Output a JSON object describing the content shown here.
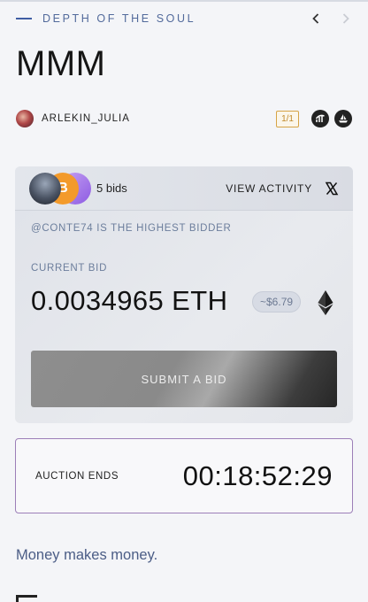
{
  "collection": {
    "name": "DEPTH OF THE SOUL"
  },
  "artwork": {
    "title": "MMM",
    "description": "Money makes money."
  },
  "creator": {
    "name": "ARLEKIN_JULIA"
  },
  "edition": {
    "label": "1/1"
  },
  "bids": {
    "count_label": "5 bids",
    "view_activity_label": "VIEW ACTIVITY",
    "highest_bidder_text": "@CONTE74 IS THE HIGHEST BIDDER",
    "bitcoin_glyph": "B"
  },
  "current_bid": {
    "label": "CURRENT BID",
    "amount": "0.0034965 ETH",
    "usd": "~$6.79"
  },
  "actions": {
    "submit_label": "SUBMIT A BID"
  },
  "auction": {
    "label": "AUCTION ENDS",
    "countdown": "00:18:52:29"
  },
  "colors": {
    "accent": "#3f5ea3",
    "edition_badge": "#c0892a",
    "auction_border": "#9c7fb8",
    "muted_text": "#6c7e9c"
  },
  "icons": [
    "chevron-left-icon",
    "chevron-right-icon",
    "chart-icon",
    "boat-icon",
    "x-logo-icon",
    "ethereum-icon"
  ]
}
